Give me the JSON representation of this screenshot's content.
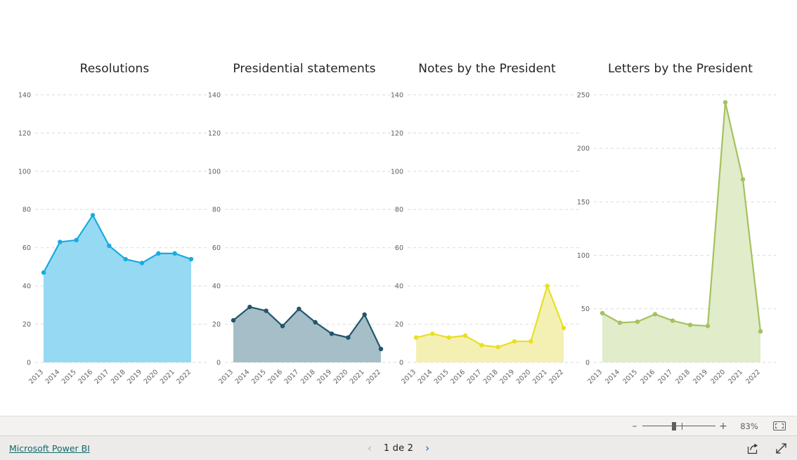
{
  "footer": {
    "powerbi_link": "Microsoft Power BI",
    "page_label": "1 de 2",
    "prev_icon": "‹",
    "next_icon": "›",
    "share_icon": "share-icon",
    "fullscreen_icon": "fullscreen-icon"
  },
  "zoombar": {
    "minus": "–",
    "plus": "+",
    "zoom_level": "83%",
    "fit_icon": "fit-to-page-icon",
    "slider_position_pct": 42
  },
  "chart_data": [
    {
      "type": "area",
      "title": "Resolutions",
      "xlabel": "",
      "ylabel": "",
      "categories": [
        "2013",
        "2014",
        "2015",
        "2016",
        "2017",
        "2018",
        "2019",
        "2020",
        "2021",
        "2022"
      ],
      "values": [
        47,
        63,
        64,
        77,
        61,
        54,
        52,
        57,
        57,
        54
      ],
      "ylim": [
        0,
        140
      ],
      "yticks": [
        0,
        20,
        40,
        60,
        80,
        100,
        120,
        140
      ],
      "grid": true,
      "legend": "none",
      "line_color": "#18ABE0",
      "fill_color": "#96D9F2",
      "marker_color": "#18ABE0"
    },
    {
      "type": "area",
      "title": "Presidential statements",
      "xlabel": "",
      "ylabel": "",
      "categories": [
        "2013",
        "2014",
        "2015",
        "2016",
        "2017",
        "2018",
        "2019",
        "2020",
        "2021",
        "2022"
      ],
      "values": [
        22,
        29,
        27,
        19,
        28,
        21,
        15,
        13,
        25,
        7
      ],
      "ylim": [
        0,
        140
      ],
      "yticks": [
        0,
        20,
        40,
        60,
        80,
        100,
        120,
        140
      ],
      "grid": true,
      "legend": "none",
      "line_color": "#21556B",
      "fill_color": "#A5BEC7",
      "marker_color": "#21556B"
    },
    {
      "type": "area",
      "title": "Notes by the President",
      "xlabel": "",
      "ylabel": "",
      "categories": [
        "2013",
        "2014",
        "2015",
        "2016",
        "2017",
        "2018",
        "2019",
        "2020",
        "2021",
        "2022"
      ],
      "values": [
        13,
        15,
        13,
        14,
        9,
        8,
        11,
        11,
        40,
        18
      ],
      "ylim": [
        0,
        140
      ],
      "yticks": [
        0,
        20,
        40,
        60,
        80,
        100,
        120,
        140
      ],
      "grid": true,
      "legend": "none",
      "line_color": "#E8E021",
      "fill_color": "#F4F0B4",
      "marker_color": "#E8E021"
    },
    {
      "type": "area",
      "title": "Letters by the President",
      "xlabel": "",
      "ylabel": "",
      "categories": [
        "2013",
        "2014",
        "2015",
        "2016",
        "2017",
        "2018",
        "2019",
        "2020",
        "2021",
        "2022"
      ],
      "values": [
        46,
        37,
        38,
        45,
        39,
        35,
        34,
        243,
        171,
        29
      ],
      "ylim": [
        0,
        250
      ],
      "yticks": [
        0,
        50,
        100,
        150,
        200,
        250
      ],
      "grid": true,
      "legend": "none",
      "line_color": "#A4C25E",
      "fill_color": "#E1ECCA",
      "marker_color": "#A4C25E"
    }
  ]
}
